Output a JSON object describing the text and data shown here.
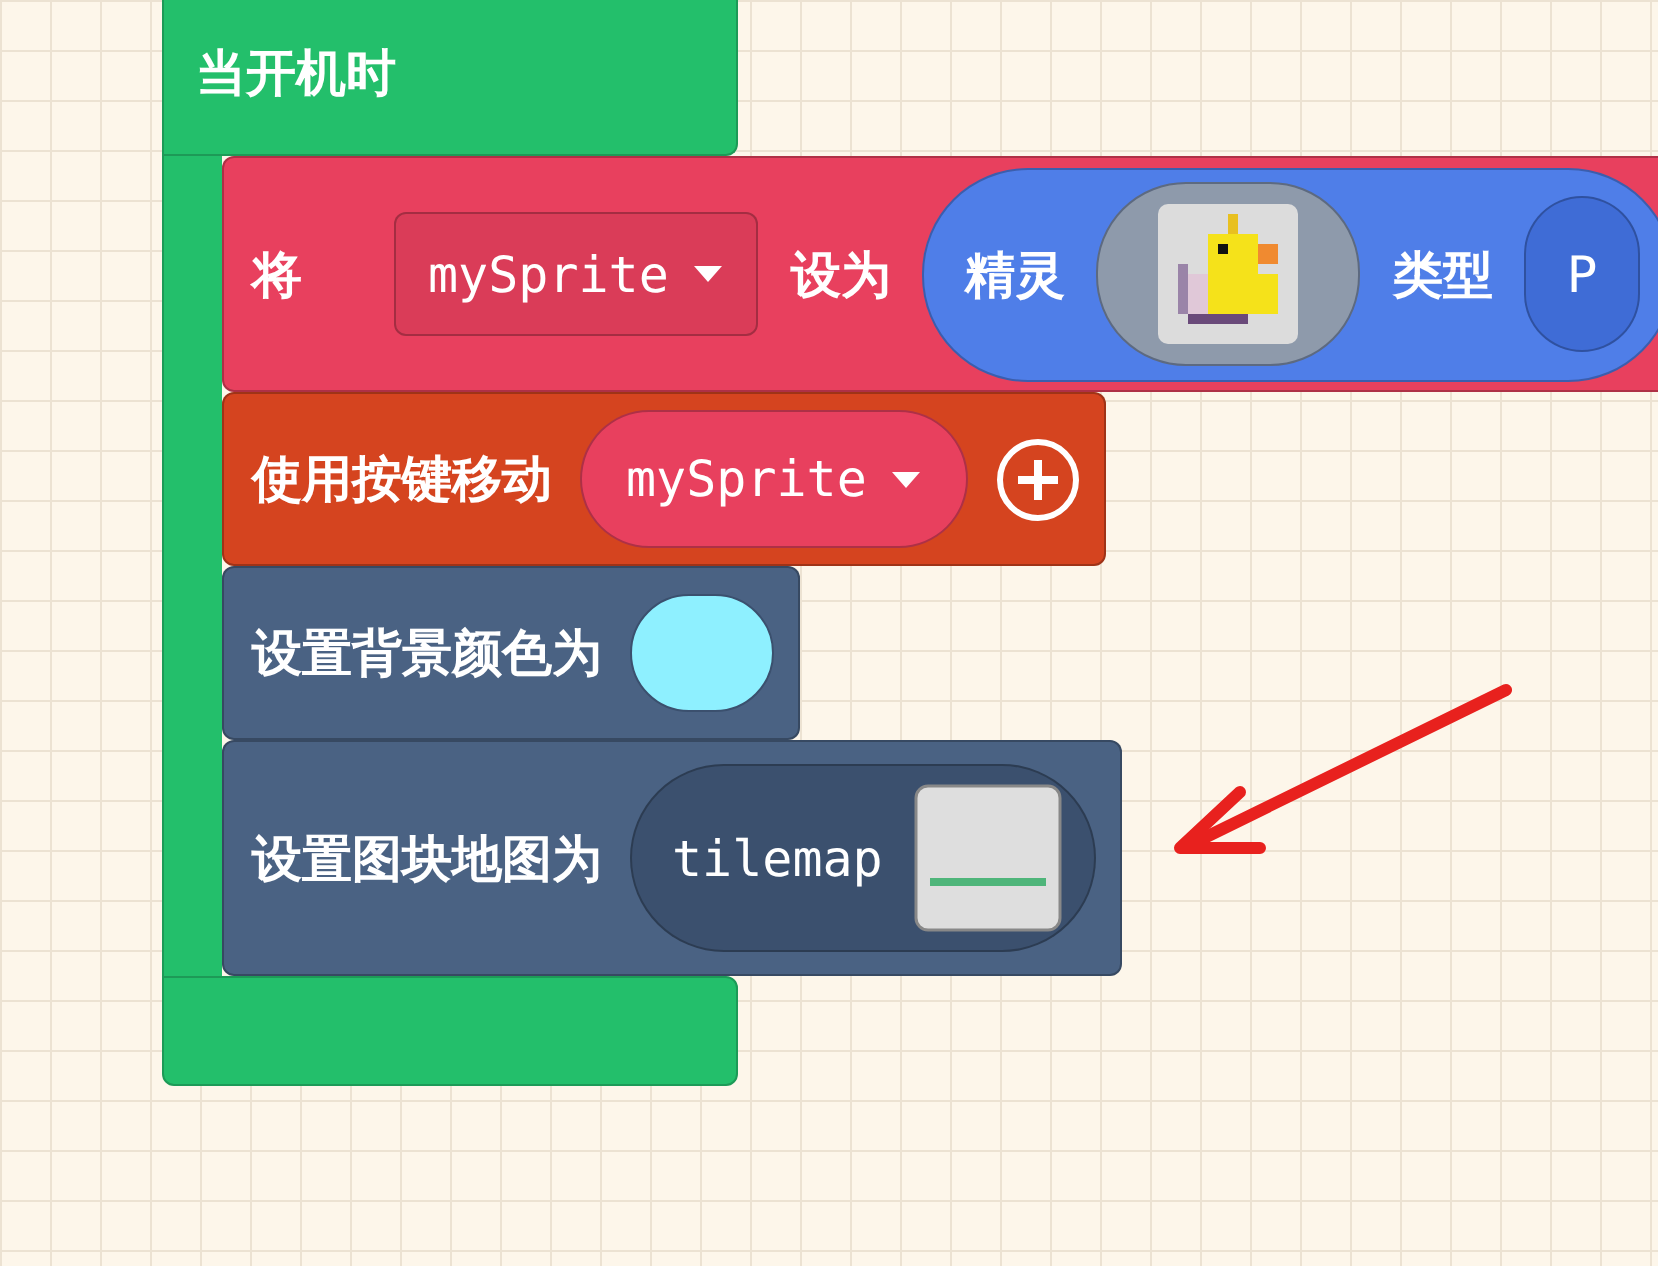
{
  "hat_block": {
    "label": "当开机时",
    "color": "#23bf6b"
  },
  "blocks": [
    {
      "kind": "tall",
      "color": "#e8405e",
      "parts": [
        {
          "kind": "text",
          "text": "将"
        },
        {
          "kind": "dropdown",
          "text": "mySprite"
        },
        {
          "kind": "text",
          "text": "设为"
        },
        {
          "kind": "pill",
          "color": "#4f7ee8",
          "parts": [
            {
              "kind": "text",
              "text": "精灵"
            },
            {
              "kind": "sprite_image"
            },
            {
              "kind": "text",
              "text": "类型"
            },
            {
              "kind": "inner_pill",
              "text": "P"
            }
          ]
        }
      ]
    },
    {
      "kind": "short",
      "color": "#d5441f",
      "parts": [
        {
          "kind": "text",
          "text": "使用按键移动"
        },
        {
          "kind": "dropdown_pill",
          "text": "mySprite"
        },
        {
          "kind": "add_button"
        }
      ]
    },
    {
      "kind": "short",
      "color": "#4a6283",
      "parts": [
        {
          "kind": "text",
          "text": "设置背景颜色为"
        },
        {
          "kind": "color_swatch",
          "color": "#8ef0ff"
        }
      ]
    },
    {
      "kind": "tall",
      "color": "#4a6283",
      "parts": [
        {
          "kind": "text",
          "text": "设置图块地图为"
        },
        {
          "kind": "pill",
          "color": "#3b506e",
          "parts": [
            {
              "kind": "mono",
              "text": "tilemap"
            },
            {
              "kind": "tile_image"
            }
          ]
        }
      ]
    }
  ],
  "annotation": {
    "kind": "arrow",
    "color": "#e8211e"
  }
}
